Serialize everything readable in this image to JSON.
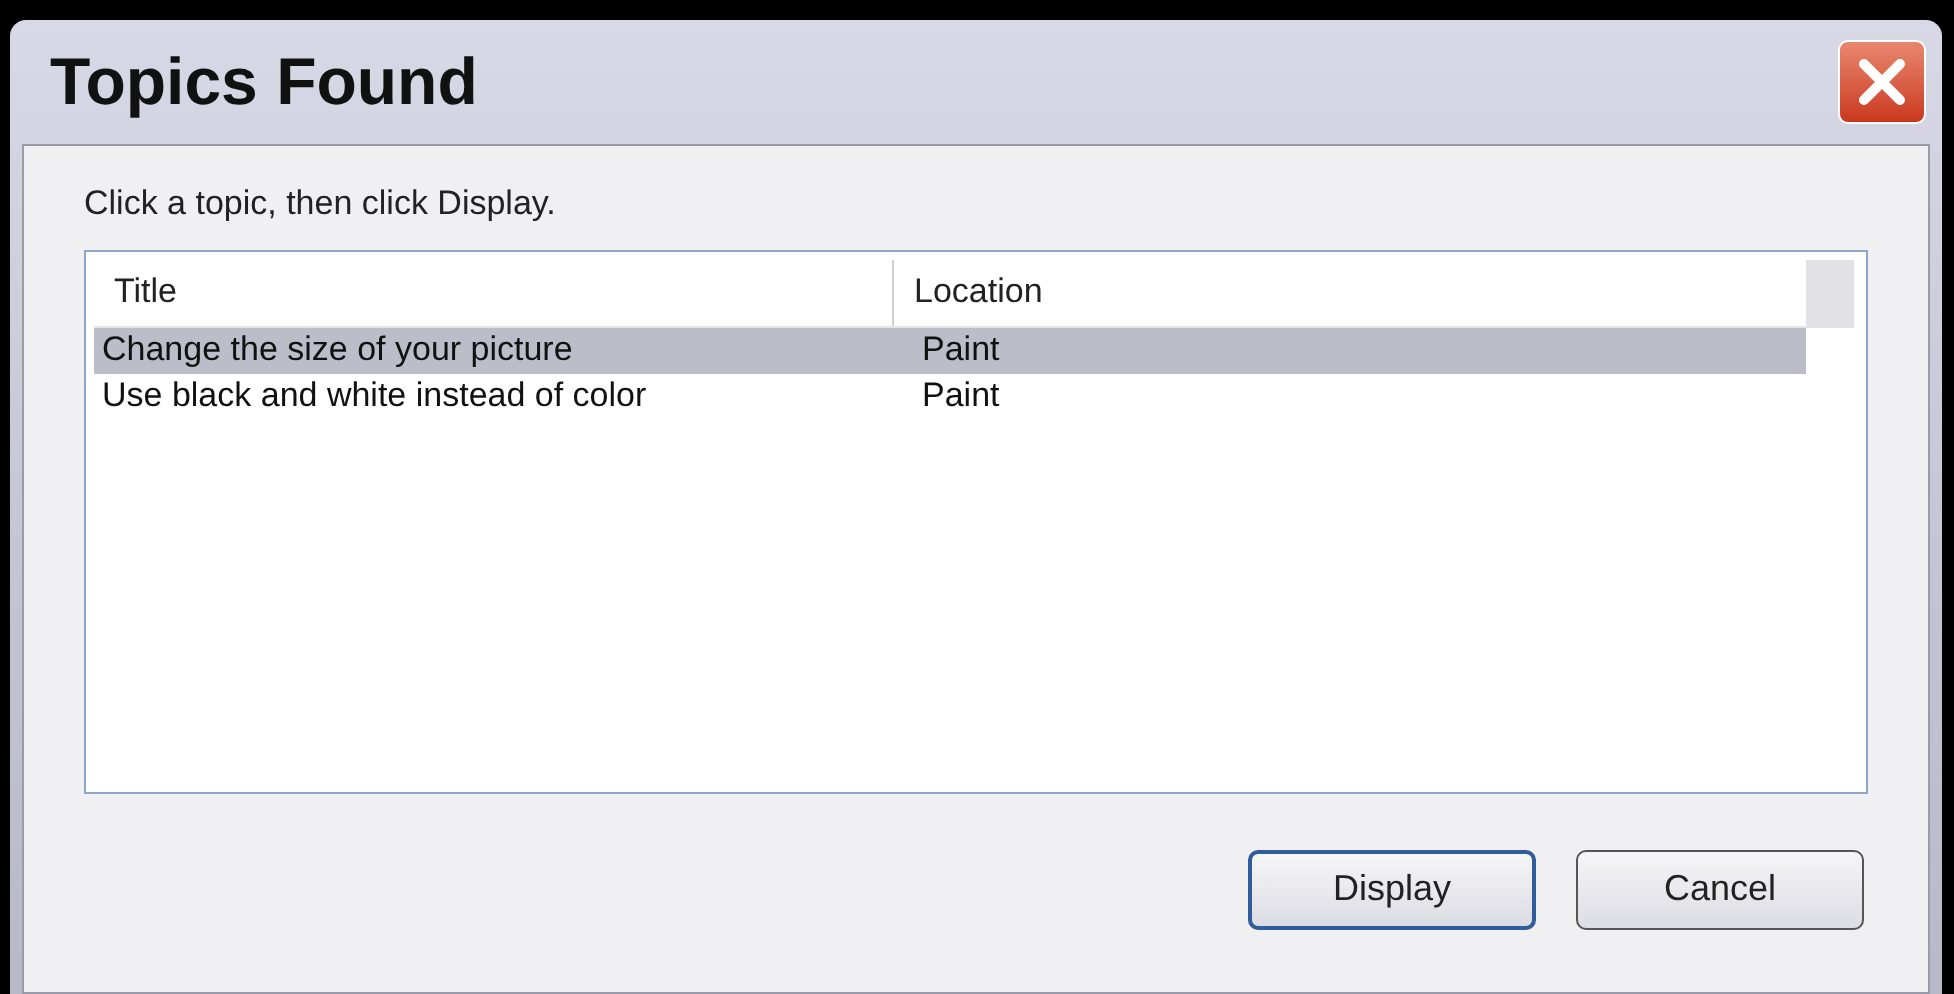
{
  "window": {
    "title": "Topics Found"
  },
  "instruction": "Click a topic, then click Display.",
  "table": {
    "columns": [
      "Title",
      "Location"
    ],
    "rows": [
      {
        "cells": [
          "Change the size of your picture",
          "Paint"
        ],
        "selected": true
      },
      {
        "cells": [
          "Use black and white instead of color",
          "Paint"
        ],
        "selected": false
      }
    ]
  },
  "buttons": [
    {
      "label": "Display",
      "default": true
    },
    {
      "label": "Cancel",
      "default": false
    }
  ]
}
